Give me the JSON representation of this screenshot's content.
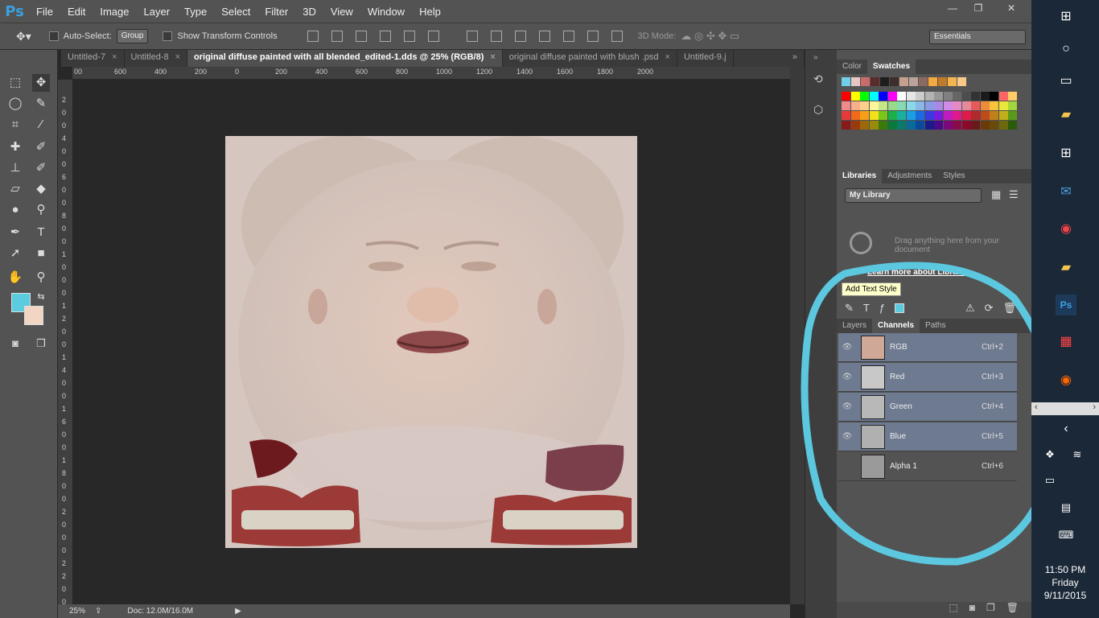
{
  "app": {
    "logo": "Ps"
  },
  "menu": [
    "File",
    "Edit",
    "Image",
    "Layer",
    "Type",
    "Select",
    "Filter",
    "3D",
    "View",
    "Window",
    "Help"
  ],
  "window_controls": {
    "minimize": "—",
    "restore": "❐",
    "close": "✕"
  },
  "options": {
    "auto_select_label": "Auto-Select:",
    "auto_select_value": "Group",
    "transform_label": "Show Transform Controls",
    "mode_label": "3D Mode:",
    "workspace": "Essentials"
  },
  "tabs": [
    {
      "label": "Untitled-7",
      "close": "×"
    },
    {
      "label": "Untitled-8",
      "close": "×"
    },
    {
      "label": "original diffuse painted with all blended_edited-1.dds @ 25% (RGB/8)",
      "close": "×"
    },
    {
      "label": "original diffuse painted with blush .psd",
      "close": "×"
    },
    {
      "label": "Untitled-9.j",
      "close": ""
    }
  ],
  "tabs_overflow": "»",
  "ruler_h": [
    "00",
    "600",
    "400",
    "200",
    "0",
    "200",
    "400",
    "600",
    "800",
    "1000",
    "1200",
    "1400",
    "1600",
    "1800",
    "2000"
  ],
  "ruler_v": [
    "2",
    "0",
    "0",
    "4",
    "0",
    "0",
    "6",
    "0",
    "0",
    "8",
    "0",
    "0",
    "1",
    "0",
    "0",
    "0",
    "1",
    "2",
    "0",
    "0",
    "1",
    "4",
    "0",
    "0",
    "1",
    "6",
    "0",
    "0",
    "1",
    "8",
    "0",
    "0",
    "2",
    "0",
    "0",
    "0",
    "2",
    "2",
    "0",
    "0"
  ],
  "status": {
    "zoom": "25%",
    "doc": "Doc: 12.0M/16.0M"
  },
  "swatch_panel": {
    "tabs": [
      "Color",
      "Swatches"
    ],
    "active": "Swatches"
  },
  "colors": {
    "fg": "#5bcbe0",
    "bg": "#f2d5c2",
    "accent_circle": "#5cc8e0",
    "swatch_top": [
      "#6fd0e8",
      "#e7c7c3",
      "#c96c6c",
      "#5a2d2d",
      "#1e1e1e",
      "#3b2e2b",
      "#c5a08f",
      "#b9a39b",
      "#8b6a5f",
      "#f6a840",
      "#c07a2a",
      "#f1b64d",
      "#f7ca8a"
    ],
    "swatch_grid": [
      "#ff0000",
      "#ffff00",
      "#00ff00",
      "#00ffff",
      "#0000ff",
      "#ff00ff",
      "#ffffff",
      "#e6e6e6",
      "#cccccc",
      "#b3b3b3",
      "#999999",
      "#808080",
      "#666666",
      "#4d4d4d",
      "#333333",
      "#1a1a1a",
      "#000000",
      "#ff6666",
      "#ffcc66",
      "#f28a8a",
      "#f7b08a",
      "#fdd08a",
      "#fff59a",
      "#c6e68a",
      "#9ad98a",
      "#86d9b0",
      "#8ad9e6",
      "#8ab8e6",
      "#8a9ae6",
      "#a88ae6",
      "#d18ae6",
      "#e68ac6",
      "#e68a9a",
      "#e65a5a",
      "#ee8b3a",
      "#f6c33a",
      "#e8e83a",
      "#a3d63a",
      "#e63a3a",
      "#f06a1a",
      "#f6a01a",
      "#f2e01a",
      "#7ac61a",
      "#1ab04a",
      "#1ab0a0",
      "#1aa0e0",
      "#1a6ae0",
      "#3a3ae0",
      "#7a1ae0",
      "#c01ac0",
      "#e01a8a",
      "#e01a4a",
      "#b02a2a",
      "#c04a1a",
      "#c0801a",
      "#c0b01a",
      "#5a9a1a",
      "#8a1a1a",
      "#9a3a0a",
      "#9a6a0a",
      "#9a8a0a",
      "#3a7a0a",
      "#0a7a3a",
      "#0a7a6a",
      "#0a6a9a",
      "#0a4a9a",
      "#1a1a8a",
      "#4a0a8a",
      "#7a0a7a",
      "#8a0a4a",
      "#8a0a2a",
      "#6a1a1a",
      "#6a3a0a",
      "#6a4a0a",
      "#6a6a0a",
      "#2a5a0a"
    ]
  },
  "libraries": {
    "tabs": [
      "Libraries",
      "Adjustments",
      "Styles"
    ],
    "dropdown": "My Library",
    "drag_text": "Drag anything here from your document",
    "learn_link": "Learn more about Libraries",
    "tooltip": "Add Text Style"
  },
  "layers_panel": {
    "tabs": [
      "Layers",
      "Channels",
      "Paths"
    ],
    "active": "Channels"
  },
  "channels": [
    {
      "name": "RGB",
      "key": "Ctrl+2",
      "visible": "👁",
      "selected": true
    },
    {
      "name": "Red",
      "key": "Ctrl+3",
      "visible": "👁",
      "selected": true
    },
    {
      "name": "Green",
      "key": "Ctrl+4",
      "visible": "👁",
      "selected": true
    },
    {
      "name": "Blue",
      "key": "Ctrl+5",
      "visible": "👁",
      "selected": true
    },
    {
      "name": "Alpha 1",
      "key": "Ctrl+6",
      "visible": "",
      "selected": false
    }
  ],
  "taskbar": {
    "time": "11:50 PM",
    "day": "Friday",
    "date": "9/11/2015"
  }
}
